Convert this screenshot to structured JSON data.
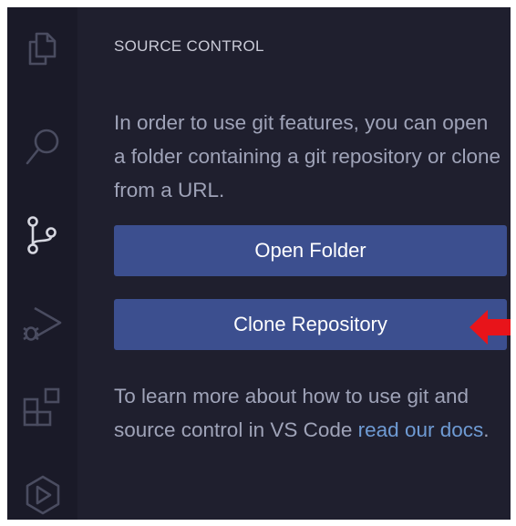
{
  "sidebar": {
    "title": "SOURCE CONTROL",
    "info_text": "In order to use git features, you can open a folder containing a git repository or clone from a URL.",
    "open_folder_label": "Open Folder",
    "clone_repository_label": "Clone Repository",
    "learn_text": "To learn more about how to use git and source control in VS Code",
    "docs_link_text": "read our docs",
    "learn_text_end": "."
  },
  "activity_bar": {
    "items": [
      {
        "icon": "explorer-icon",
        "active": false
      },
      {
        "icon": "search-icon",
        "active": false
      },
      {
        "icon": "source-control-icon",
        "active": true
      },
      {
        "icon": "run-debug-icon",
        "active": false
      },
      {
        "icon": "extensions-icon",
        "active": false
      },
      {
        "icon": "remote-explorer-icon",
        "active": false
      }
    ]
  },
  "colors": {
    "background": "#1f1f2e",
    "activity_bar": "#1a1a28",
    "button": "#3c4f8f",
    "link": "#6f9bd4",
    "text": "#9fa3b8",
    "icon_inactive": "#4a4c60",
    "icon_active": "#d6d7e0",
    "annotation_arrow": "#e8141a"
  }
}
